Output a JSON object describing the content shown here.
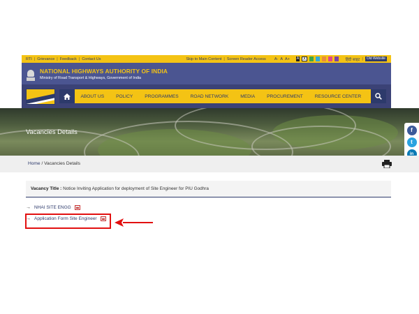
{
  "topbar": {
    "links_left": [
      "RTI",
      "Grievance",
      "Feedback",
      "Contact Us"
    ],
    "skip_link": "Skip to Main Content",
    "screen_reader": "Screen Reader Access",
    "font_controls": [
      "A-",
      "A",
      "A+"
    ],
    "contrast_controls": [
      "A",
      "A"
    ],
    "theme_swatches": [
      "#3da54a",
      "#31a9d8",
      "#e88b3e",
      "#e0478a",
      "#7a43a8"
    ],
    "language": "हिंदी साइट",
    "old_website": "Old Website"
  },
  "header": {
    "title": "NATIONAL HIGHWAYS AUTHORITY OF INDIA",
    "subtitle": "Ministry of Road Transport & Highways, Government of India"
  },
  "nav": {
    "items": [
      "ABOUT US",
      "POLICY",
      "PROGRAMMES",
      "ROAD NETWORK",
      "MEDIA",
      "PROCUREMENT",
      "RESOURCE CENTER"
    ]
  },
  "banner": {
    "heading": "Vacancies Details"
  },
  "social": {
    "facebook": "f",
    "twitter": "t",
    "linkedin": "in"
  },
  "breadcrumb": {
    "home": "Home",
    "separator": "/",
    "current": "Vacancies Details"
  },
  "vacancy": {
    "label": "Vacancy Title :",
    "value": "Notice Inviting Application for deployment of Site Engineer for PIU Godhra"
  },
  "documents": [
    {
      "arrow": "→",
      "label": "NHAI SITE ENGG"
    },
    {
      "arrow": "→",
      "label": "Application Form Site Engineer"
    }
  ],
  "colors": {
    "accent_yellow": "#f4c314",
    "navy": "#2d3a6b",
    "highlight_red": "#e21010"
  }
}
